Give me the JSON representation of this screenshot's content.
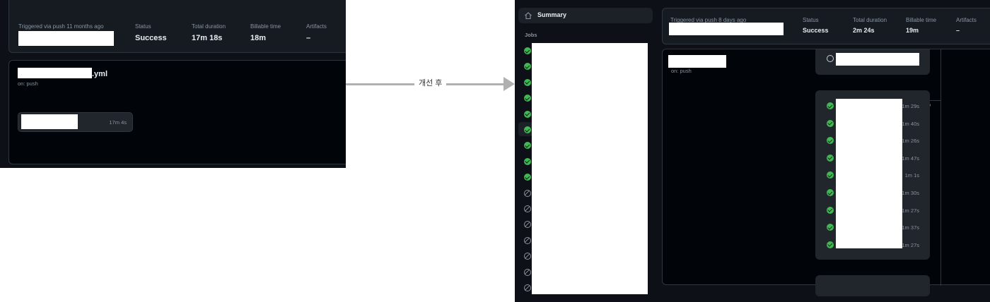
{
  "before": {
    "summary": {
      "triggered": "Triggered via push 11 months ago",
      "status_label": "Status",
      "status_value": "Success",
      "duration_label": "Total duration",
      "duration_value": "17m 18s",
      "billable_label": "Billable time",
      "billable_value": "18m",
      "artifacts_label": "Artifacts",
      "artifacts_value": "–"
    },
    "workflow": {
      "file_suffix": ".yml",
      "trigger": "on: push"
    },
    "job": {
      "duration": "17m 4s"
    }
  },
  "arrow": {
    "label": "개선 후"
  },
  "after": {
    "sidebar": {
      "summary_label": "Summary",
      "jobs_heading": "Jobs",
      "job_statuses": [
        "success",
        "success",
        "success",
        "success",
        "success",
        "success",
        "success",
        "success",
        "success",
        "skipped",
        "skipped",
        "skipped",
        "skipped",
        "skipped",
        "skipped",
        "skipped"
      ]
    },
    "summary": {
      "triggered": "Triggered via push 8 days ago",
      "status_label": "Status",
      "status_value": "Success",
      "duration_label": "Total duration",
      "duration_value": "2m 24s",
      "billable_label": "Billable time",
      "billable_value": "19m",
      "artifacts_label": "Artifacts",
      "artifacts_value": "–"
    },
    "workflow": {
      "trigger": "on: push"
    },
    "matrix_jobs": [
      {
        "duration": "1m 29s"
      },
      {
        "duration": "1m 40s"
      },
      {
        "duration": "1m 26s"
      },
      {
        "duration": "1m 47s"
      },
      {
        "duration": "1m 1s"
      },
      {
        "duration": "1m 30s"
      },
      {
        "duration": "1m 27s"
      },
      {
        "duration": "1m 37s"
      },
      {
        "duration": "1m 27s"
      }
    ]
  },
  "colors": {
    "background": "#0d1117",
    "panel": "#161b22",
    "border": "#30363d",
    "success": "#3fb950",
    "muted_text": "#8b949e"
  }
}
